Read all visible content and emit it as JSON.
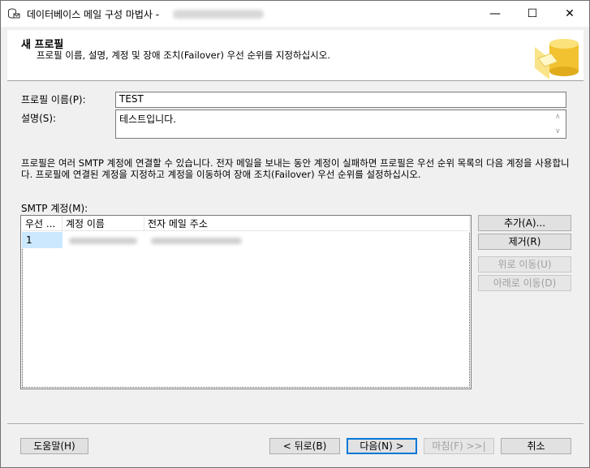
{
  "window": {
    "title": "데이터베이스 메일 구성 마법사 -",
    "controls": {
      "minimize": "—",
      "maximize": "☐",
      "close": "✕"
    }
  },
  "banner": {
    "title": "새 프로필",
    "subtitle": "프로필 이름, 설명, 계정 및 장애 조치(Failover) 우선 순위를 지정하십시오."
  },
  "form": {
    "profile_name_label": "프로필 이름(P):",
    "profile_name_value": "TEST",
    "description_label": "설명(S):",
    "description_value": "테스트입니다."
  },
  "info_text": "프로필은 여러 SMTP 계정에 연결할 수 있습니다. 전자 메일을 보내는 동안 계정이 실패하면 프로필은 우선 순위 목록의 다음 계정을 사용합니다. 프로필에 연결된 계정을 지정하고 계정을 이동하여 장애 조치(Failover) 우선 순위를 설정하십시오.",
  "smtp": {
    "label": "SMTP 계정(M):",
    "columns": [
      "우선 ...",
      "계정 이름",
      "전자 메일 주소"
    ],
    "rows": [
      {
        "priority": "1"
      }
    ]
  },
  "side_buttons": {
    "add": "추가(A)...",
    "remove": "제거(R)",
    "move_up": "위로 이동(U)",
    "move_down": "아래로 이동(D)"
  },
  "footer": {
    "help": "도움말(H)",
    "back": "< 뒤로(B)",
    "next": "다음(N) >",
    "finish": "마침(F) >>|",
    "cancel": "취소"
  },
  "colors": {
    "accent": "#0078d7",
    "selection": "#cce8ff",
    "disabled_text": "#a0a0a0"
  }
}
